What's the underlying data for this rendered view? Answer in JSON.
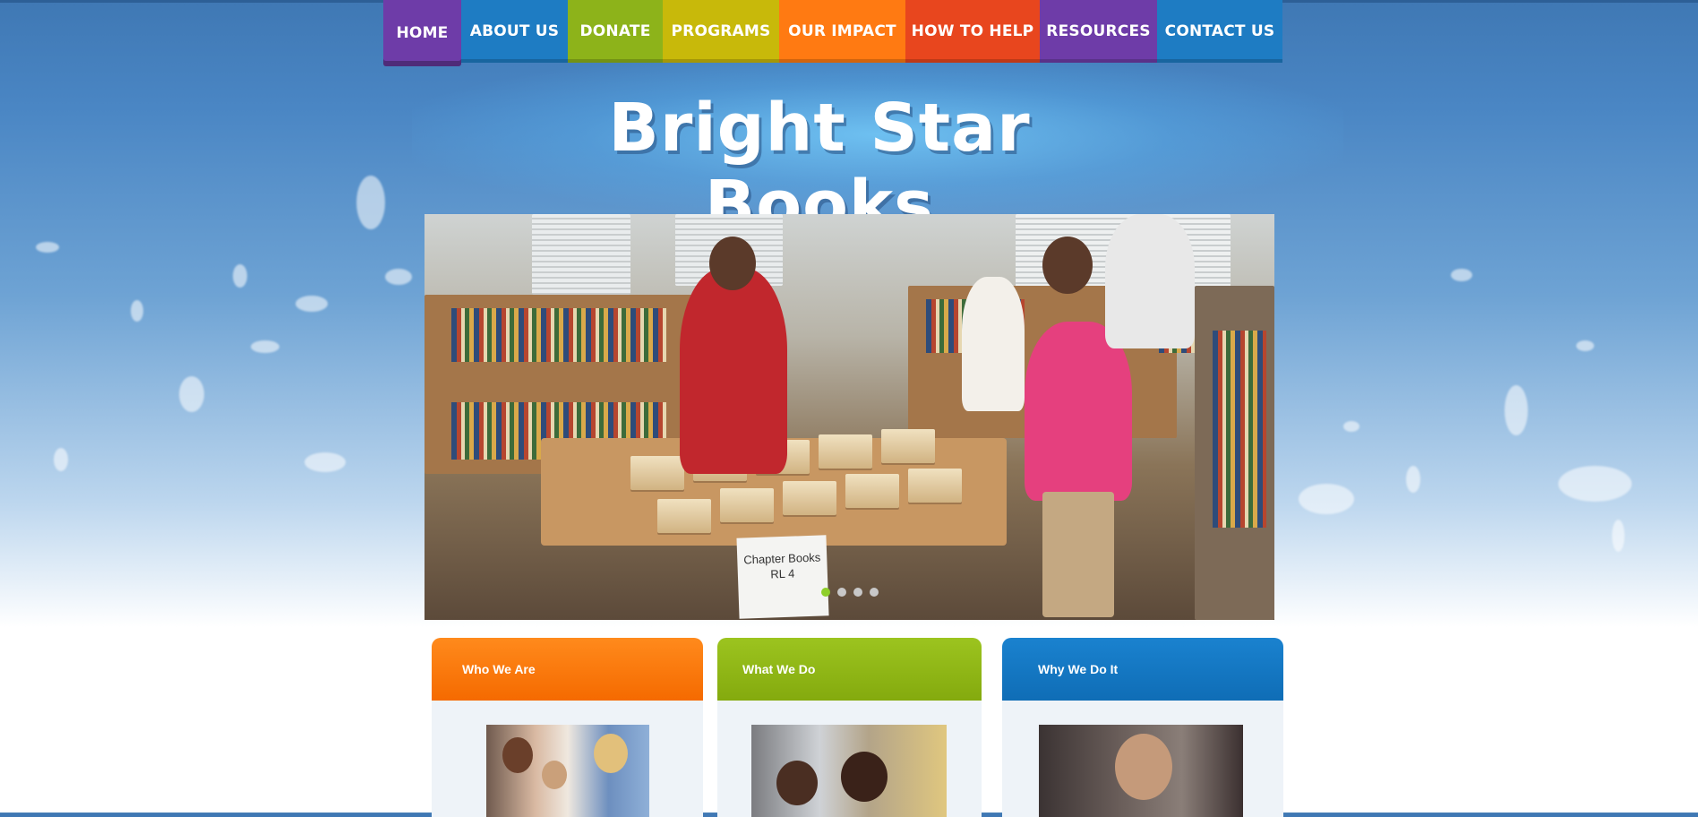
{
  "nav": {
    "items": [
      {
        "label": "HOME",
        "color": "#6e3ca8",
        "active": true
      },
      {
        "label": "ABOUT US",
        "color": "#1e7cc3"
      },
      {
        "label": "DONATE",
        "color": "#8db31a"
      },
      {
        "label": "PROGRAMS",
        "color": "#c8b90a"
      },
      {
        "label": "OUR IMPACT",
        "color": "#ff7a12"
      },
      {
        "label": "HOW TO HELP",
        "color": "#e8461e"
      },
      {
        "label": "RESOURCES",
        "color": "#6e3ca8"
      },
      {
        "label": "CONTACT US",
        "color": "#1e7cc3"
      }
    ]
  },
  "site": {
    "title": "Bright Star Books"
  },
  "slider": {
    "sign_text": "Chapter Books\nRL 4",
    "slide_count": 4,
    "active_index": 0
  },
  "cards": [
    {
      "title": "Who We Are",
      "color_top": "#ff8a1c",
      "color_bottom": "#f56a00"
    },
    {
      "title": "What We Do",
      "color_top": "#9cc41f",
      "color_bottom": "#84aa0e"
    },
    {
      "title": "Why We Do It",
      "color_top": "#1a82cf",
      "color_bottom": "#0f6db6"
    }
  ]
}
